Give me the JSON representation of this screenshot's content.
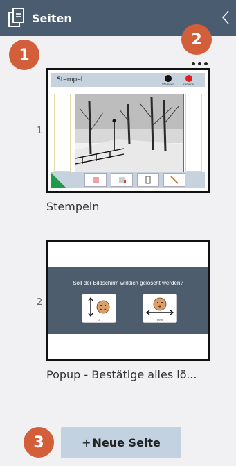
{
  "header": {
    "title": "Seiten",
    "icon": "pages-icon",
    "back_icon": "chevron-left-icon"
  },
  "badges": [
    "1",
    "2",
    "3"
  ],
  "pages": [
    {
      "number": "1",
      "caption": "Stempeln",
      "thumb": {
        "title": "Stempel",
        "top_right_labels": [
          "Stempel",
          "Radierer"
        ]
      }
    },
    {
      "number": "2",
      "caption": "Popup - Bestätige alles lö...",
      "thumb": {
        "question": "Soll der Bildschirm wirklich gelöscht werden?",
        "yes_label": "ja",
        "no_label": "nein"
      }
    }
  ],
  "actions": {
    "more_icon": "more-horizontal-icon",
    "new_page_plus": "+",
    "new_page_label": "Neue Seite"
  },
  "colors": {
    "header_bg": "#4a5d70",
    "badge": "#d35e3a",
    "button_bg": "#c2d2e0",
    "dialog_bg": "#4d5d6d"
  }
}
